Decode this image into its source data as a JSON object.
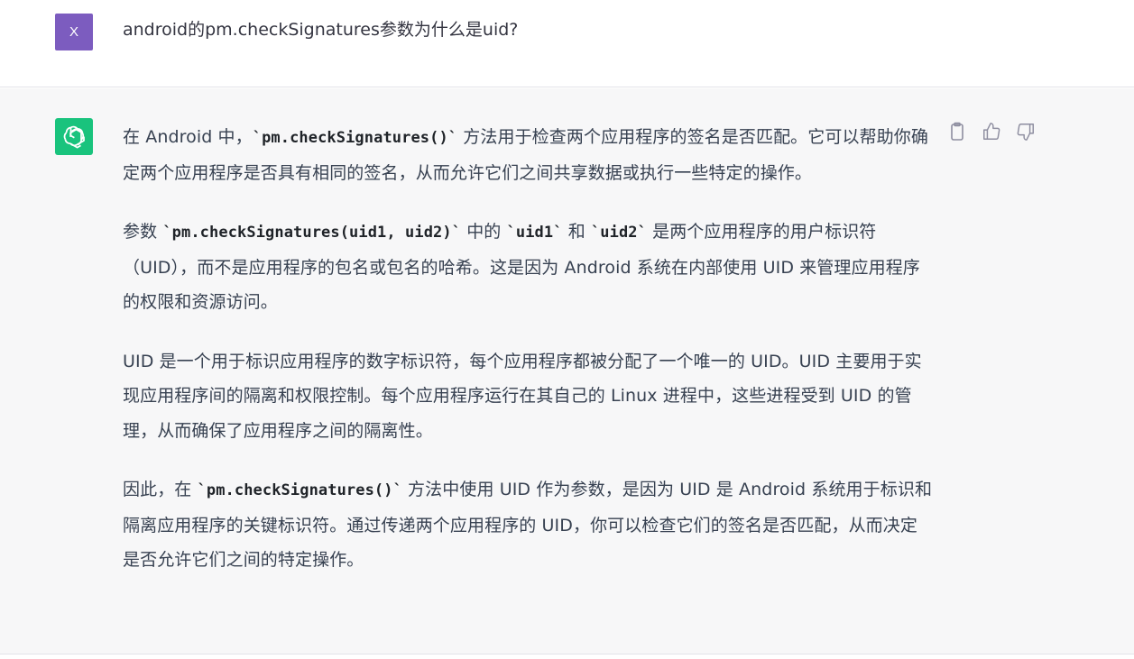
{
  "user": {
    "avatar_letter": "X",
    "message": "android的pm.checkSignatures参数为什么是uid?"
  },
  "assistant": {
    "avatar_icon": "openai-logo-icon",
    "paragraphs": [
      {
        "p1a": "在 Android 中，",
        "code1": "`pm.checkSignatures()`",
        "p1b": " 方法用于检查两个应用程序的签名是否匹配。它可以帮助你确定两个应用程序是否具有相同的签名，从而允许它们之间共享数据或执行一些特定的操作。"
      },
      {
        "p2a": "参数 ",
        "code1": "`pm.checkSignatures(uid1, uid2)`",
        "p2b": " 中的 ",
        "code2": "`uid1`",
        "p2c": " 和 ",
        "code3": "`uid2`",
        "p2d": " 是两个应用程序的用户标识符（UID），而不是应用程序的包名或包名的哈希。这是因为 Android 系统在内部使用 UID 来管理应用程序的权限和资源访问。"
      },
      {
        "text": "UID 是一个用于标识应用程序的数字标识符，每个应用程序都被分配了一个唯一的 UID。UID 主要用于实现应用程序间的隔离和权限控制。每个应用程序运行在其自己的 Linux 进程中，这些进程受到 UID 的管理，从而确保了应用程序之间的隔离性。"
      },
      {
        "p4a": "因此，在 ",
        "code1": "`pm.checkSignatures()`",
        "p4b": " 方法中使用 UID 作为参数，是因为 UID 是 Android 系统用于标识和隔离应用程序的关键标识符。通过传递两个应用程序的 UID，你可以检查它们的签名是否匹配，从而决定是否允许它们之间的特定操作。"
      }
    ],
    "actions": [
      {
        "icon": "clipboard-icon"
      },
      {
        "icon": "thumbs-up-icon"
      },
      {
        "icon": "thumbs-down-icon"
      }
    ]
  },
  "colors": {
    "user_avatar": "#7c5cbf",
    "bot_avatar": "#19c37d",
    "assistant_bg": "#f7f7f8",
    "text": "#374151"
  }
}
